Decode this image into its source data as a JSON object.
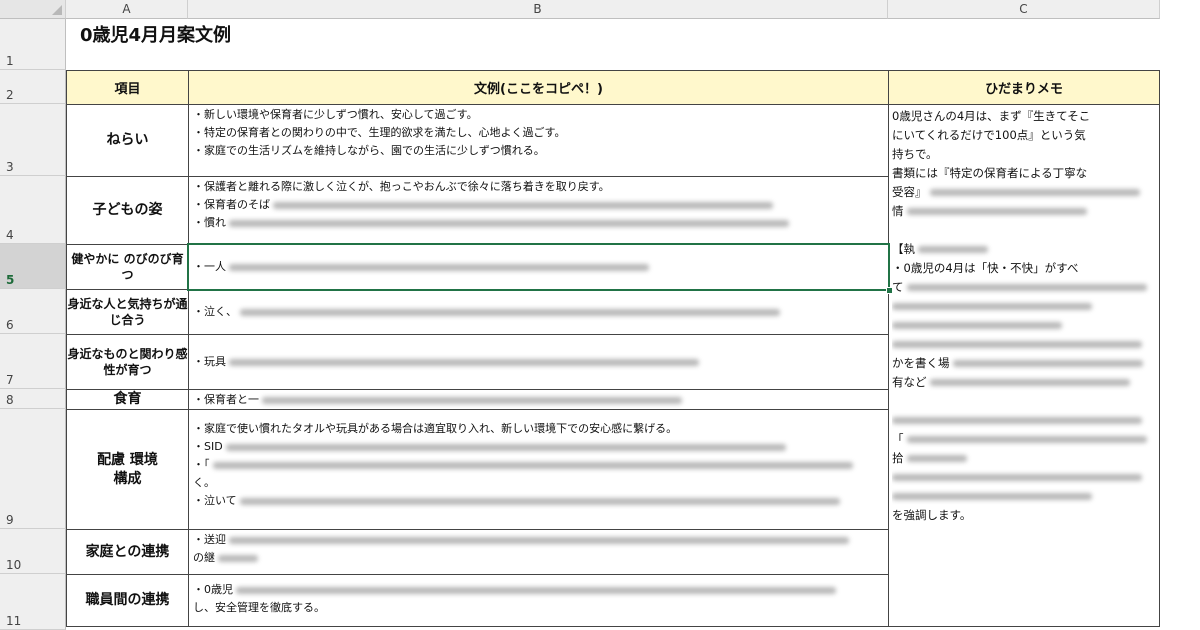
{
  "columns": [
    "A",
    "B",
    "C"
  ],
  "rows": [
    "1",
    "2",
    "3",
    "4",
    "5",
    "6",
    "7",
    "8",
    "9",
    "10",
    "11"
  ],
  "title": "0歳児4月月案文例",
  "header": {
    "item": "項目",
    "example": "文例(ここをコピペ！)",
    "memo": "ひだまりメモ"
  },
  "items": [
    {
      "label": "ねらい",
      "lines": [
        "・新しい環境や保育者に少しずつ慣れ、安心して過ごす。",
        "・特定の保育者との関わりの中で、生理的欲求を満たし、心地よく過ごす。",
        "・家庭での生活リズムを維持しながら、園での生活に少しずつ慣れる。"
      ]
    },
    {
      "label": "子どもの姿",
      "lines": [
        "・保護者と離れる際に激しく泣くが、抱っこやおんぶで徐々に落ち着きを取り戻す。",
        "・保育者のそば",
        "・慣れ"
      ]
    },
    {
      "label": "健やかに のびのび育つ",
      "lines": [
        "・一人"
      ]
    },
    {
      "label": "身近な人と気持ちが通じ合う",
      "lines": [
        "・泣く、"
      ]
    },
    {
      "label": "身近なものと関わり感性が育つ",
      "lines": [
        "・玩具"
      ]
    },
    {
      "label": "食育",
      "lines": [
        "・保育者と一"
      ]
    },
    {
      "label": "配慮 環境構成",
      "lines": [
        "・家庭で使い慣れたタオルや玩具がある場合は適宜取り入れ、新しい環境下での安心感に繋げる。",
        "・SID",
        "・「",
        "く。",
        "・泣いて"
      ]
    },
    {
      "label": "家庭との連携",
      "lines": [
        "・送迎",
        "の継"
      ]
    },
    {
      "label": "職員間の連携",
      "lines": [
        "・0歳児",
        "し、安全管理を徹底する。"
      ]
    }
  ],
  "memo_lines": [
    "0歳児さんの4月は、まず『生きてそこ",
    "にいてくれるだけで100点』という気",
    "持ちで。",
    "書類には『特定の保育者による丁寧な",
    "受容』",
    "情",
    "",
    "【執",
    "・0歳児の4月は「快・不快」がすべ",
    "て",
    "",
    "",
    "",
    "かを書く場",
    "有など",
    "",
    "",
    "「",
    "拾",
    "",
    "",
    "を強調します。"
  ]
}
